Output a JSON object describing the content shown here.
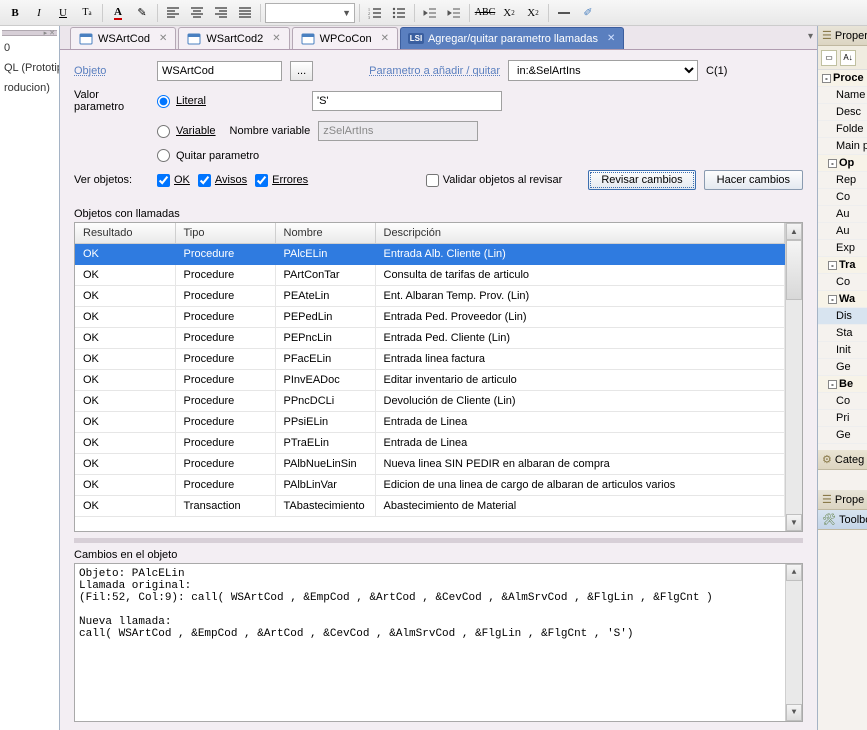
{
  "toolbar": {},
  "left_panel": {
    "items": [
      "",
      "0",
      "",
      "QL (Prototip",
      "",
      "roducion)"
    ]
  },
  "tabs": [
    {
      "label": "WSArtCod",
      "type": "ws"
    },
    {
      "label": "WSartCod2",
      "type": "ws"
    },
    {
      "label": "WPCoCon",
      "type": "ws"
    },
    {
      "label": "Agregar/quitar parametro llamadas",
      "type": "lsi"
    }
  ],
  "active_tab": 3,
  "form": {
    "object_label": "Objeto",
    "object_value": "WSArtCod",
    "browse_btn": "...",
    "param_label": "Parametro a añadir / quitar",
    "param_select": "in:&SelArtIns",
    "c_label": "C(1)",
    "valor_label": "Valor parametro",
    "literal_label": "Literal",
    "variable_label": "Variable",
    "quitar_label": "Quitar parametro",
    "literal_value": "'S'",
    "nombre_var_label": "Nombre variable",
    "nombre_var_value": "zSelArtIns",
    "ver_objetos_label": "Ver objetos:",
    "ok_label": "OK",
    "avisos_label": "Avisos",
    "errores_label": "Errores",
    "validar_label": "Validar objetos al revisar",
    "revisar_btn": "Revisar cambios",
    "hacer_btn": "Hacer cambios"
  },
  "table": {
    "title": "Objetos con llamadas",
    "cols": [
      "Resultado",
      "Tipo",
      "Nombre",
      "Descripción"
    ],
    "rows": [
      {
        "r": "OK",
        "t": "Procedure",
        "n": "PAlcELin",
        "d": "Entrada Alb. Cliente (Lin)"
      },
      {
        "r": "OK",
        "t": "Procedure",
        "n": "PArtConTar",
        "d": "Consulta de tarifas de articulo"
      },
      {
        "r": "OK",
        "t": "Procedure",
        "n": "PEAteLin",
        "d": "Ent. Albaran Temp. Prov. (Lin)"
      },
      {
        "r": "OK",
        "t": "Procedure",
        "n": "PEPedLin",
        "d": "Entrada Ped. Proveedor (Lin)"
      },
      {
        "r": "OK",
        "t": "Procedure",
        "n": "PEPncLin",
        "d": "Entrada Ped. Cliente (Lin)"
      },
      {
        "r": "OK",
        "t": "Procedure",
        "n": "PFacELin",
        "d": "Entrada linea factura"
      },
      {
        "r": "OK",
        "t": "Procedure",
        "n": "PInvEADoc",
        "d": "Editar inventario de articulo"
      },
      {
        "r": "OK",
        "t": "Procedure",
        "n": "PPncDCLi",
        "d": "Devolución de Cliente (Lin)"
      },
      {
        "r": "OK",
        "t": "Procedure",
        "n": "PPsiELin",
        "d": "Entrada de Linea"
      },
      {
        "r": "OK",
        "t": "Procedure",
        "n": "PTraELin",
        "d": "Entrada de Linea"
      },
      {
        "r": "OK",
        "t": "Procedure",
        "n": "PAlbNueLinSin",
        "d": "Nueva linea SIN PEDIR en albaran de compra"
      },
      {
        "r": "OK",
        "t": "Procedure",
        "n": "PAlbLinVar",
        "d": "Edicion de una linea de cargo de albaran de articulos varios"
      },
      {
        "r": "OK",
        "t": "Transaction",
        "n": "TAbastecimiento",
        "d": "Abastecimiento de Material"
      }
    ],
    "selected": 0
  },
  "log": {
    "title": "Cambios en el objeto",
    "text": "Objeto: PAlcELin\nLlamada original:\n(Fil:52, Col:9): call( WSArtCod , &EmpCod , &ArtCod , &CevCod , &AlmSrvCod , &FlgLin , &FlgCnt )\n\nNueva llamada:\ncall( WSArtCod , &EmpCod , &ArtCod , &CevCod , &AlmSrvCod , &FlgLin , &FlgCnt , 'S')\n"
  },
  "right": {
    "properties": "Propert",
    "group1": "Proce",
    "items1": [
      "Name",
      "Desc",
      "Folde",
      "Main p"
    ],
    "group2": "Op",
    "items2": [
      "Rep",
      "Co",
      "Au",
      "Au",
      "Exp"
    ],
    "group3": "Tra",
    "items3": [
      "Co"
    ],
    "group4": "Wa",
    "items4": [
      "Dis",
      "Sta",
      "Init",
      "Ge"
    ],
    "group5": "Be",
    "items5": [
      "Co",
      "Pri",
      "Ge"
    ],
    "cat": "Categ",
    "prop2": "Prope",
    "toolbox": "Toolbo"
  }
}
